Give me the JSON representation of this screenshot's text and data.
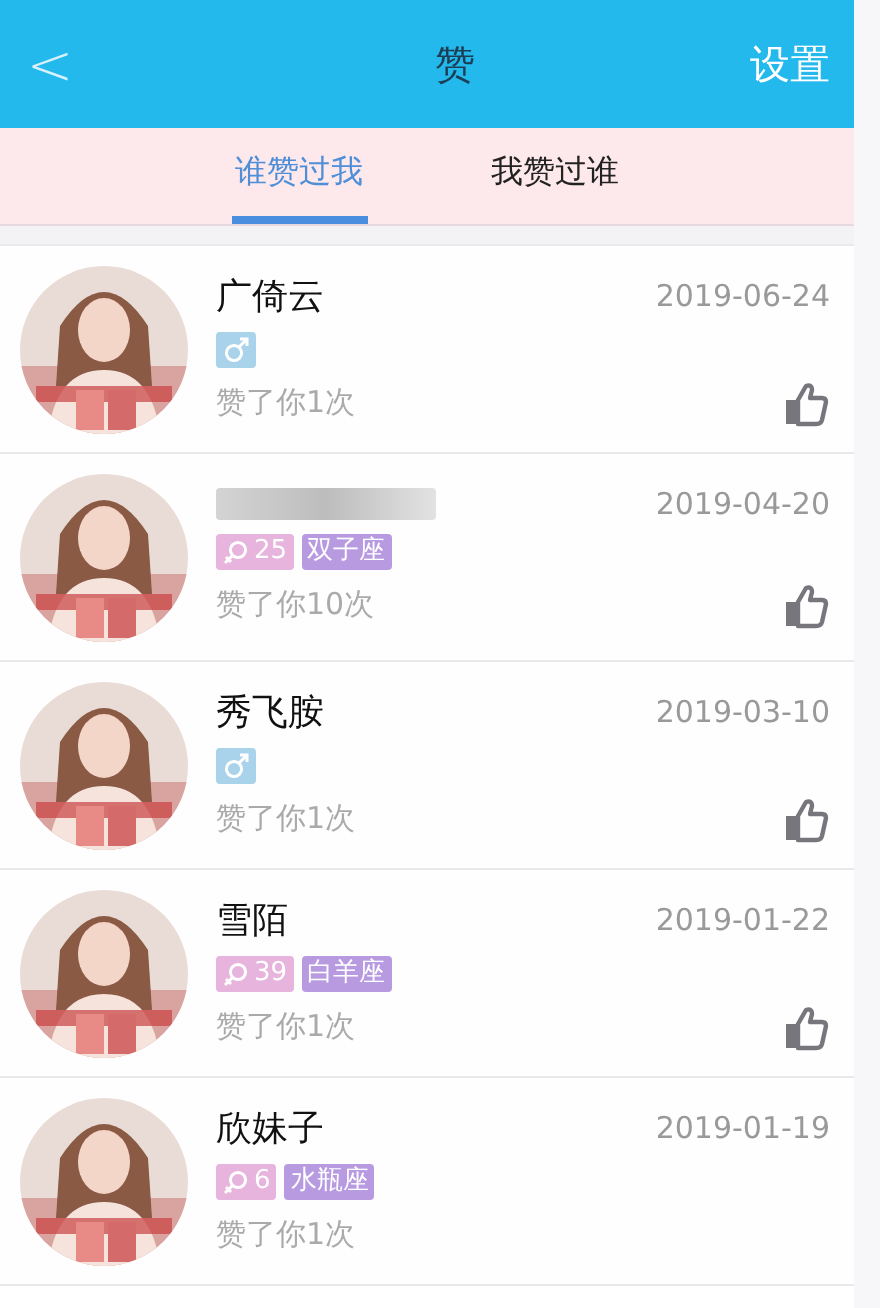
{
  "header": {
    "back": "<",
    "title": "赞",
    "action": "设置"
  },
  "tabs": [
    {
      "label": "谁赞过我",
      "selected": true
    },
    {
      "label": "我赞过谁",
      "selected": false
    }
  ],
  "likes": [
    {
      "name": "广倚云",
      "name_blurred": false,
      "date": "2019-06-24",
      "kind": "male",
      "count": "赞了你1次",
      "thumb": true
    },
    {
      "name_blurred": true,
      "date": "2019-04-20",
      "kind": "female",
      "age": "25",
      "zodiac": "双子座",
      "count": "赞了你10次",
      "thumb": true
    },
    {
      "name": "秀飞胺",
      "name_blurred": false,
      "date": "2019-03-10",
      "kind": "male",
      "count": "赞了你1次",
      "thumb": true
    },
    {
      "name": "雪陌",
      "name_blurred": false,
      "date": "2019-01-22",
      "kind": "female",
      "age": "39",
      "zodiac": "白羊座",
      "count": "赞了你1次",
      "thumb": true
    },
    {
      "name": "欣妹子",
      "name_blurred": false,
      "date": "2019-01-19",
      "kind": "female",
      "age": "6",
      "zodiac": "水瓶座",
      "count": "赞了你1次",
      "thumb": false
    }
  ]
}
